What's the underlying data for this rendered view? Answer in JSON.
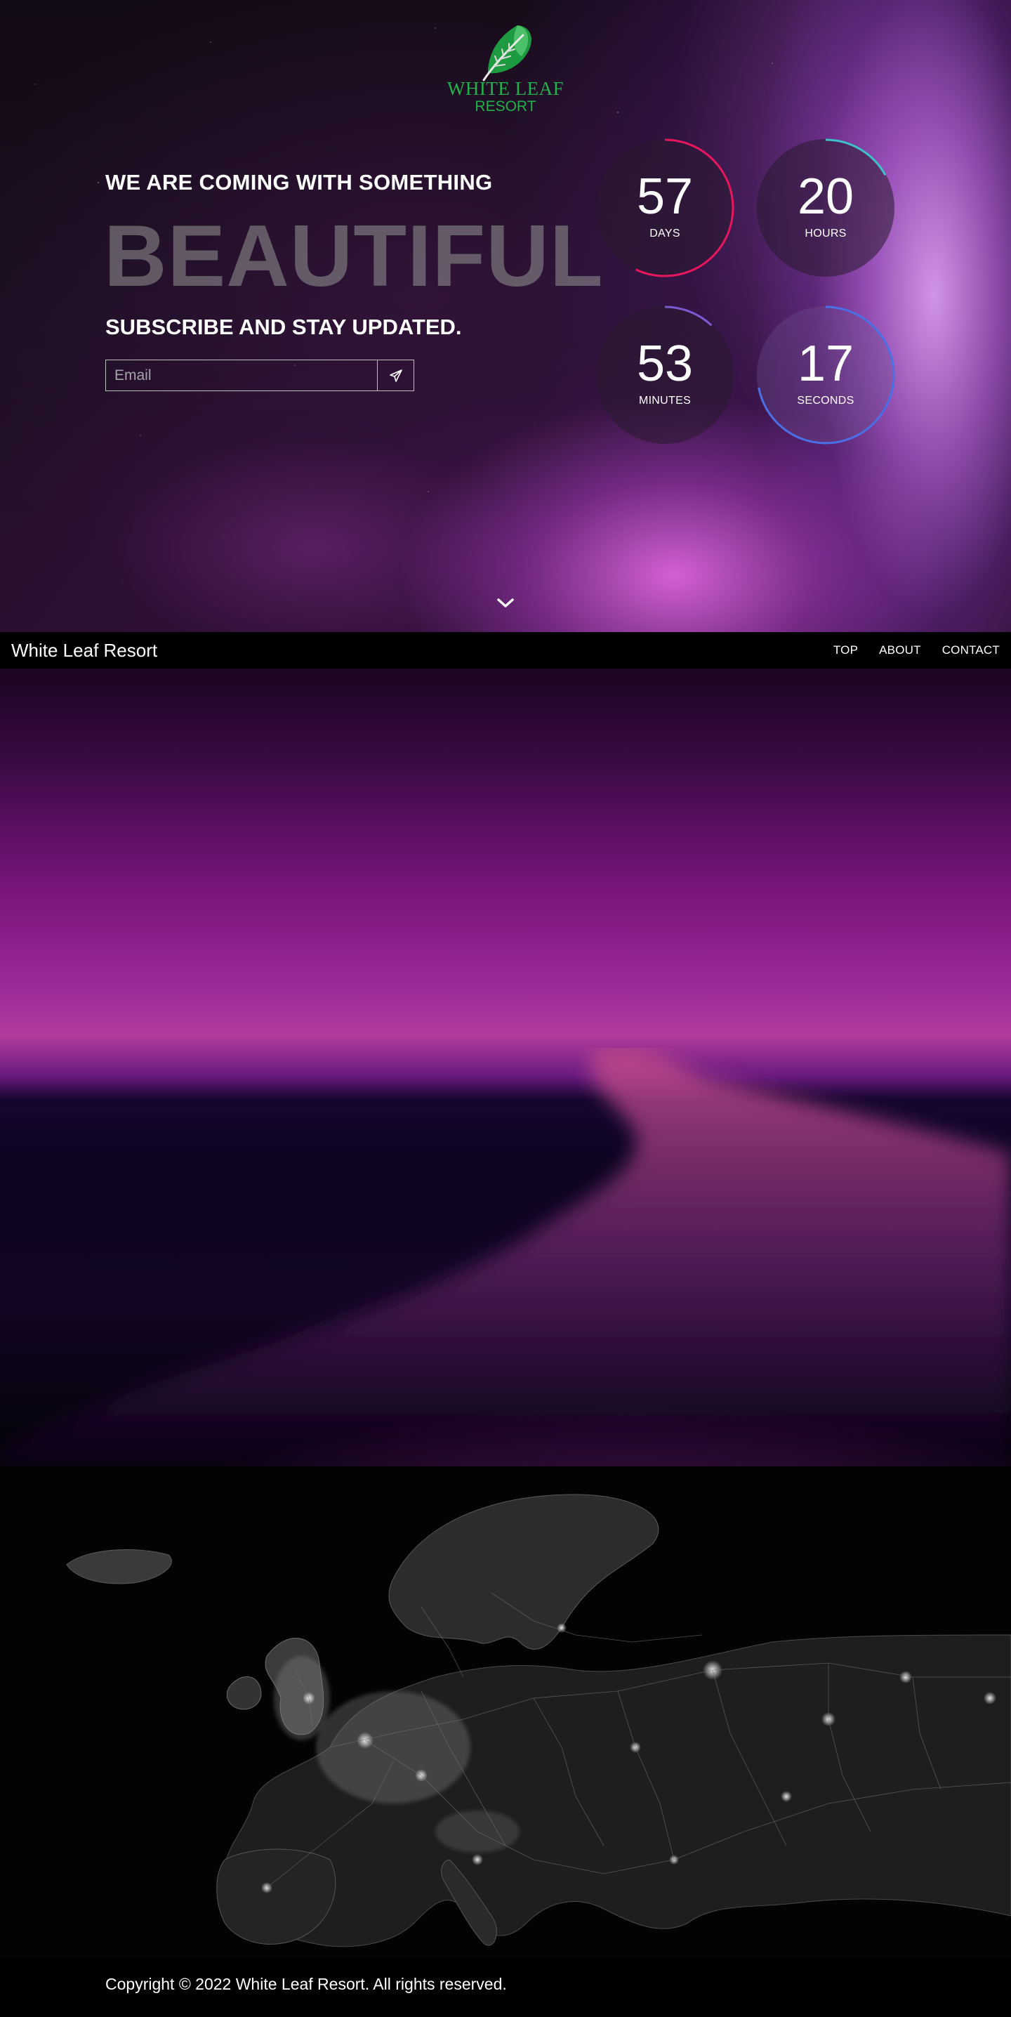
{
  "logo": {
    "name": "WHITE LEAF",
    "subtitle": "RESORT",
    "color": "#21b24b"
  },
  "hero": {
    "headline": "WE ARE COMING WITH SOMETHING",
    "big_word": "BEAUTIFUL",
    "subscribe_title": "SUBSCRIBE AND STAY UPDATED.",
    "email_placeholder": "Email",
    "send_icon": "paper-plane-icon",
    "scroll_icon": "chevron-down-icon"
  },
  "countdown": [
    {
      "value": "57",
      "label": "DAYS",
      "color": "#e8175d",
      "progress": 0.57
    },
    {
      "value": "20",
      "label": "HOURS",
      "color": "#3fc1c9",
      "progress": 0.17
    },
    {
      "value": "53",
      "label": "MINUTES",
      "color": "#7b5bd0",
      "progress": 0.12
    },
    {
      "value": "17",
      "label": "SECONDS",
      "color": "#4b6fe6",
      "progress": 0.72
    }
  ],
  "nav": {
    "brand": "White Leaf Resort",
    "links": [
      "TOP",
      "ABOUT",
      "CONTACT"
    ]
  },
  "footer": {
    "copyright": "Copyright © 2022 White Leaf Resort. All rights reserved."
  }
}
